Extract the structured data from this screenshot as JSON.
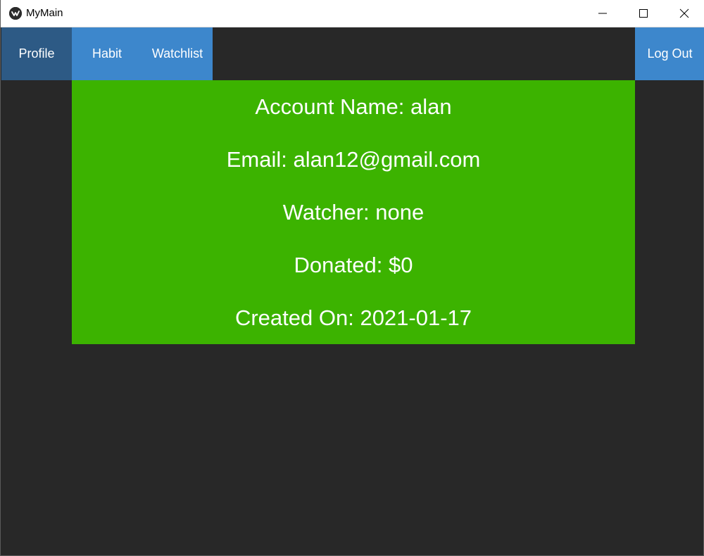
{
  "window": {
    "title": "MyMain",
    "icon": "kivy-logo-icon",
    "controls": {
      "minimize_icon": "minimize-icon",
      "maximize_icon": "maximize-icon",
      "close_icon": "close-icon"
    }
  },
  "nav": {
    "tabs": [
      {
        "label": "Profile",
        "active": true
      },
      {
        "label": "Habit",
        "active": false
      },
      {
        "label": "Watchlist",
        "active": false
      }
    ],
    "logout_label": "Log Out"
  },
  "profile": {
    "account_name": "Account Name: alan",
    "email": "Email: alan12@gmail.com",
    "watcher": "Watcher: none",
    "donated": "Donated: $0",
    "created_on": "Created On: 2021-01-17"
  },
  "colors": {
    "background": "#282828",
    "nav_button": "#3d87cc",
    "nav_active": "#2d5a85",
    "panel_green": "#3cb300",
    "text": "#ffffff"
  }
}
